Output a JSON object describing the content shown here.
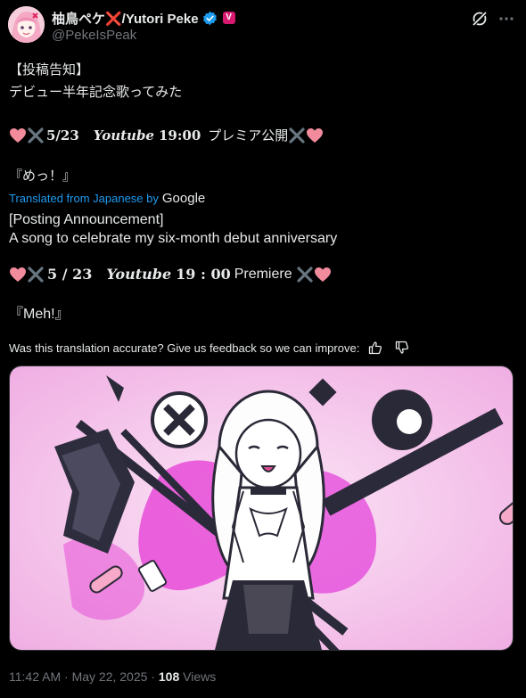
{
  "author": {
    "display_name": "柚鳥ペケ❌/Yutori Peke",
    "handle": "@PekeIsPeak"
  },
  "tweet": {
    "line1": "【投稿告知】",
    "line2": "デビュー半年記念歌ってみた",
    "date_text": "5/23",
    "youtube_word": "Youtube",
    "time_text": "19:00",
    "premiere_text": "プレミア公開",
    "song_title": "『めっ！』"
  },
  "translation": {
    "label": "Translated from Japanese by",
    "provider": "Google",
    "line1": "[Posting Announcement]",
    "line2": "A song to celebrate my six-month debut anniversary",
    "date_text": "5 / 23",
    "youtube_word": "Youtube",
    "time_text": "19 : 00",
    "premiere_text": "Premiere",
    "song_title": "『Meh!』",
    "feedback_prompt": "Was this translation accurate? Give us feedback so we can improve:"
  },
  "meta": {
    "time": "11:42 AM",
    "date": "May 22, 2025",
    "views_count": "108",
    "views_label": "Views"
  },
  "colors": {
    "background": "#000000",
    "text": "#e7e9ea",
    "secondary": "#71767b",
    "link": "#1d9bf0",
    "verified": "#1d9bf0",
    "affiliate_badge": "#d6186f",
    "heart": "#f28b9b",
    "cross": "#66757f",
    "artwork_bg": "#f2b6e6",
    "artwork_accent": "#e23ad8"
  },
  "icons": {
    "verified": "verified-badge-icon",
    "grok": "grok-icon",
    "more": "more-icon",
    "thumbs_up": "thumbs-up-icon",
    "thumbs_down": "thumbs-down-icon"
  }
}
